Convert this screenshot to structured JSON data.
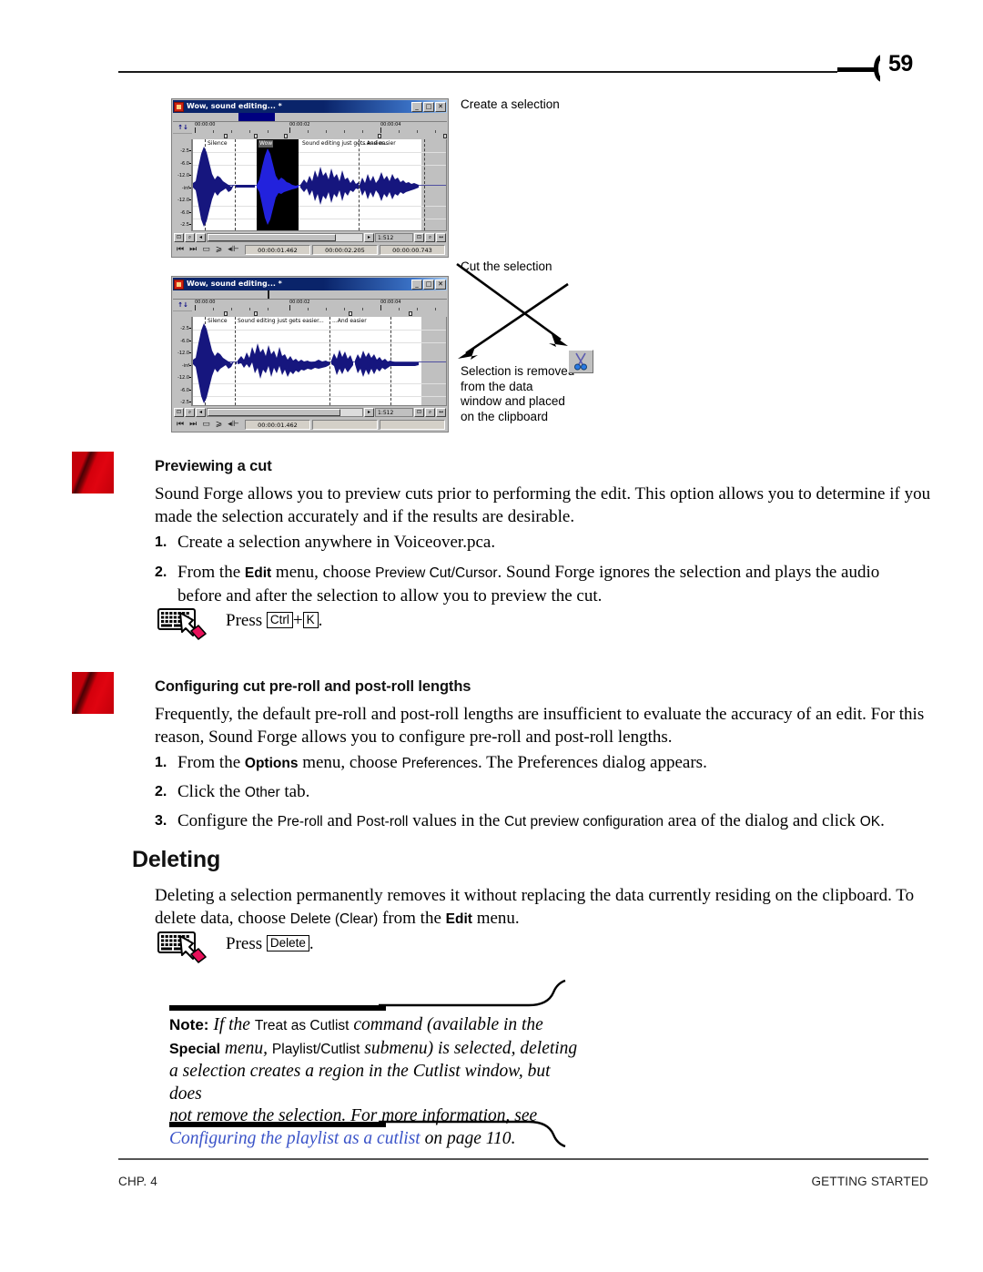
{
  "header": {
    "page_number": "59"
  },
  "figure": {
    "windows": [
      {
        "title": "Wow, sound editing... *",
        "min_label": "_",
        "max_label": "□",
        "close_label": "✕",
        "channel_label": "↑↓",
        "ruler_labels": [
          "00:00:00",
          "00:00:02",
          "00:00:04"
        ],
        "db_labels": [
          "-2.5",
          "-6.0",
          "-12.0",
          "-inf",
          "-12.0",
          "-6.0",
          "-2.5"
        ],
        "region_labels": [
          "Silence",
          "Sound editing just gets easier...",
          "...And easier"
        ],
        "selection_tag": "Wow",
        "zoom_ratio": "1:512",
        "time_fields": [
          "00:00:01.462",
          "00:00:02.205",
          "00:00:00.743"
        ]
      },
      {
        "title": "Wow, sound editing... *",
        "min_label": "_",
        "max_label": "□",
        "close_label": "✕",
        "channel_label": "↑↓",
        "ruler_labels": [
          "00:00:00",
          "00:00:02",
          "00:00:04"
        ],
        "db_labels": [
          "-2.5",
          "-6.0",
          "-12.0",
          "-inf",
          "-12.0",
          "-6.0",
          "-2.5"
        ],
        "region_labels": [
          "Silence",
          "Sound editing just gets easier...",
          "...And easier"
        ],
        "selection_tag": "",
        "zoom_ratio": "1:512",
        "time_fields": [
          "00:00:01.462",
          "",
          ""
        ]
      }
    ],
    "callouts": {
      "create_selection": "Create a selection",
      "cut_selection": "Cut the selection",
      "selection_removed": "Selection is removed\nfrom the data\nwindow and placed\non the clipboard"
    }
  },
  "sections": [
    {
      "heading": "Previewing a cut",
      "intro_line1": "Sound Forge allows you to preview cuts prior to performing the edit. This option allows you to determine if",
      "intro_line2": "you made the selection accurately and if the results are desirable.",
      "steps": [
        {
          "num": "1.",
          "text": "Create a selection anywhere in Voiceover.pca."
        }
      ],
      "step2": {
        "num": "2.",
        "pre": "From the ",
        "menu": "Edit",
        "mid": " menu, choose ",
        "command": "Preview Cut/Cursor",
        "post": ". Sound Forge ignores the selection and plays the audio",
        "line2": "before and after the selection to allow you to preview the cut."
      },
      "keyboard_hint": {
        "press": "Press",
        "key1": "Ctrl",
        "plus": "+",
        "key2": "K",
        "period": "."
      }
    },
    {
      "heading": "Configuring cut pre-roll and post-roll lengths",
      "intro_line1": "Frequently, the default pre-roll and post-roll lengths are insufficient to evaluate the accuracy of an edit. For",
      "intro_line2": "this reason, Sound Forge allows you to configure pre-roll and post-roll lengths.",
      "step1": {
        "num": "1.",
        "pre": "From the ",
        "menu": "Options",
        "mid": " menu, choose ",
        "command": "Preferences",
        "post": ". The Preferences dialog appears."
      },
      "step2": {
        "num": "2.",
        "pre": "Click the ",
        "command": "Other",
        "post": " tab."
      },
      "step3": {
        "num": "3.",
        "pre": "Configure the ",
        "c1": "Pre-roll",
        "mid1": " and ",
        "c2": "Post-roll",
        "mid2": " values in the ",
        "c3": "Cut preview configuration",
        "mid3": " area of the dialog and click ",
        "c4": "OK",
        "post": "."
      }
    }
  ],
  "deleting": {
    "heading": "Deleting",
    "para_line1": "Deleting a selection permanently removes it without replacing the data currently residing on the clipboard.",
    "para_line2_pre": "To delete data, choose ",
    "para_line2_cmd": "Delete (Clear)",
    "para_line2_mid": " from the ",
    "para_line2_menu": "Edit",
    "para_line2_post": " menu.",
    "keyboard_hint": {
      "press": "Press",
      "key1": "Delete",
      "period": "."
    }
  },
  "note": {
    "lead": "Note:",
    "t1": " If the ",
    "ui1": "Treat as Cutlist",
    "t2": " command (available in the",
    "uib1": "Special",
    "t3": " menu, ",
    "ui2": "Playlist/Cutlist",
    "t4": " submenu) is selected, deleting",
    "t5": "a selection creates a region in the Cutlist window, but does",
    "t6": "not remove the selection. For more information, see",
    "link": "Configuring the playlist as a cutlist",
    "t7": " on page ",
    "page": "110",
    "t8": "."
  },
  "footer": {
    "left": "CHP. 4",
    "right": "GETTING STARTED"
  },
  "colors": {
    "waveform": "#16167e",
    "waveform_selected": "#2222dd",
    "link": "#3a53c8",
    "marker_red": "#c4000a",
    "titlebar": "#0a246a"
  }
}
